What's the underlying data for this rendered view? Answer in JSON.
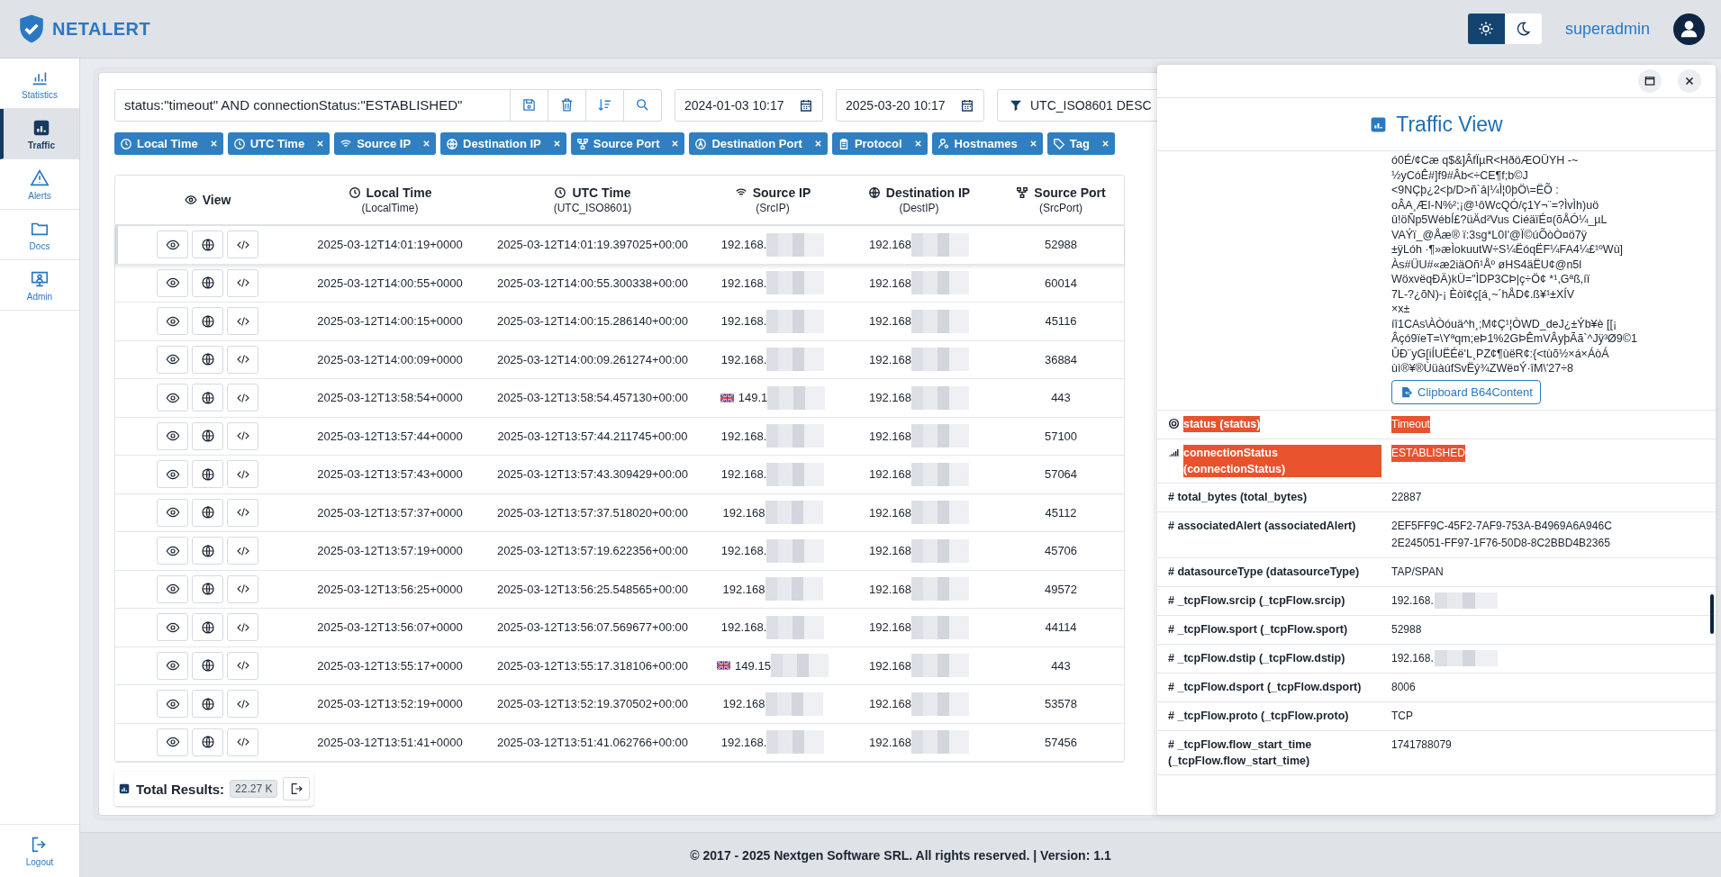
{
  "header": {
    "logo_text": "NETALERT",
    "theme_toggle": [
      {
        "kind": "light",
        "selected": true
      },
      {
        "kind": "dark",
        "selected": false
      }
    ],
    "user": "superadmin"
  },
  "sidebar": {
    "items": [
      {
        "label": "Statistics",
        "kind": "statistics",
        "selected": false
      },
      {
        "label": "Traffic",
        "kind": "traffic",
        "selected": true
      },
      {
        "label": "Alerts",
        "kind": "alerts",
        "selected": false
      },
      {
        "label": "Docs",
        "kind": "docs",
        "selected": false
      },
      {
        "label": "Admin",
        "kind": "admin",
        "selected": false
      }
    ],
    "logout": "Logout"
  },
  "toolbar": {
    "query": "status:\"timeout\" AND connectionStatus:\"ESTABLISHED\"",
    "date_from": "2024-01-03 10:17",
    "date_to": "2025-03-20 10:17",
    "sort": "UTC_ISO8601 DESC"
  },
  "column_chips": [
    {
      "label": "Local Time",
      "kind": "clock"
    },
    {
      "label": "UTC Time",
      "kind": "clock"
    },
    {
      "label": "Source IP",
      "kind": "wifi"
    },
    {
      "label": "Destination IP",
      "kind": "globe"
    },
    {
      "label": "Source Port",
      "kind": "network"
    },
    {
      "label": "Destination Port",
      "kind": "compass"
    },
    {
      "label": "Protocol",
      "kind": "clipboard"
    },
    {
      "label": "Hostnames",
      "kind": "user"
    },
    {
      "label": "Tag",
      "kind": "tag"
    }
  ],
  "table": {
    "columns": [
      {
        "title": "View",
        "kind": "eye"
      },
      {
        "title": "Local Time",
        "subtitle": "(LocalTime)",
        "kind": "clock"
      },
      {
        "title": "UTC Time",
        "subtitle": "(UTC_ISO8601)",
        "kind": "clock"
      },
      {
        "title": "Source IP",
        "subtitle": "(SrcIP)",
        "kind": "wifi"
      },
      {
        "title": "Destination IP",
        "subtitle": "(DestIP)",
        "kind": "globe"
      },
      {
        "title": "Source Port",
        "subtitle": "(SrcPort)",
        "kind": "network"
      }
    ],
    "rows": [
      {
        "local_time": "2025-03-12T14:01:19+0000",
        "utc_time": "2025-03-12T14:01:19.397025+00:00",
        "source_ip": "192.168.",
        "flag": false,
        "destination_ip": "192.168",
        "source_port": "52988",
        "selected": true
      },
      {
        "local_time": "2025-03-12T14:00:55+0000",
        "utc_time": "2025-03-12T14:00:55.300338+00:00",
        "source_ip": "192.168.",
        "flag": false,
        "destination_ip": "192.168",
        "source_port": "60014",
        "selected": false
      },
      {
        "local_time": "2025-03-12T14:00:15+0000",
        "utc_time": "2025-03-12T14:00:15.286140+00:00",
        "source_ip": "192.168.",
        "flag": false,
        "destination_ip": "192.168",
        "source_port": "45116",
        "selected": false
      },
      {
        "local_time": "2025-03-12T14:00:09+0000",
        "utc_time": "2025-03-12T14:00:09.261274+00:00",
        "source_ip": "192.168.",
        "flag": false,
        "destination_ip": "192.168",
        "source_port": "36884",
        "selected": false
      },
      {
        "local_time": "2025-03-12T13:58:54+0000",
        "utc_time": "2025-03-12T13:58:54.457130+00:00",
        "source_ip": "149.1",
        "flag": true,
        "destination_ip": "192.168",
        "source_port": "443",
        "selected": false
      },
      {
        "local_time": "2025-03-12T13:57:44+0000",
        "utc_time": "2025-03-12T13:57:44.211745+00:00",
        "source_ip": "192.168.",
        "flag": false,
        "destination_ip": "192.168",
        "source_port": "57100",
        "selected": false
      },
      {
        "local_time": "2025-03-12T13:57:43+0000",
        "utc_time": "2025-03-12T13:57:43.309429+00:00",
        "source_ip": "192.168.",
        "flag": false,
        "destination_ip": "192.168",
        "source_port": "57064",
        "selected": false
      },
      {
        "local_time": "2025-03-12T13:57:37+0000",
        "utc_time": "2025-03-12T13:57:37.518020+00:00",
        "source_ip": "192.168",
        "flag": false,
        "destination_ip": "192.168",
        "source_port": "45112",
        "selected": false
      },
      {
        "local_time": "2025-03-12T13:57:19+0000",
        "utc_time": "2025-03-12T13:57:19.622356+00:00",
        "source_ip": "192.168.",
        "flag": false,
        "destination_ip": "192.168",
        "source_port": "45706",
        "selected": false
      },
      {
        "local_time": "2025-03-12T13:56:25+0000",
        "utc_time": "2025-03-12T13:56:25.548565+00:00",
        "source_ip": "192.168",
        "flag": false,
        "destination_ip": "192.168",
        "source_port": "49572",
        "selected": false
      },
      {
        "local_time": "2025-03-12T13:56:07+0000",
        "utc_time": "2025-03-12T13:56:07.569677+00:00",
        "source_ip": "192.168.",
        "flag": false,
        "destination_ip": "192.168",
        "source_port": "44114",
        "selected": false
      },
      {
        "local_time": "2025-03-12T13:55:17+0000",
        "utc_time": "2025-03-12T13:55:17.318106+00:00",
        "source_ip": "149.15",
        "flag": true,
        "destination_ip": "192.168",
        "source_port": "443",
        "selected": false
      },
      {
        "local_time": "2025-03-12T13:52:19+0000",
        "utc_time": "2025-03-12T13:52:19.370502+00:00",
        "source_ip": "192.168",
        "flag": false,
        "destination_ip": "192.168",
        "source_port": "53578",
        "selected": false
      },
      {
        "local_time": "2025-03-12T13:51:41+0000",
        "utc_time": "2025-03-12T13:51:41.062766+00:00",
        "source_ip": "192.168.",
        "flag": false,
        "destination_ip": "192.168",
        "source_port": "57456",
        "selected": false
      }
    ]
  },
  "total": {
    "label": "Total Results:",
    "count": "22.27 K"
  },
  "drawer": {
    "title": "Traffic View",
    "content_lines": [
      "ó0É/¢Cæ q$&]ÂfÏµR<HðöÆOÜYH -~",
      "½yCóÊ#]f9#Âb<÷CE¶f;b©J",
      "<9NÇþ¿2<þ/D>ñ`â|¼Ì¦0þÖ\\=ËÕ :",
      "oÂA¸ÆI-N%²;¡@¹ôWcQÓ/ç1Y¬¨=?ÌvÌh)uö",
      "û!öÑp5WébÍ£?üÄd²Vus CiéäïÉ¤(õÅÓ¼_µL",
      "VAÝï_@Åæ® ï:3sg*L0I'@Ï©úÕòÒ¤ö7ÿ",
      "±ÿLóh ·¶»æÌokuutW÷S¼ËóqËF¼FA4¼£¹ºWù]",
      "Às#ÜU#«æ2iäOñ¹Åº øHS4äËU¢@n5l",
      "WöxvëqÐÄ)kÜ=\"ÌDP3CÞ|ç÷Ö¢ *¹,Gªß,íï",
      "7L-?¿õN)-¡ Èòî¢ç[á¸~´hÅD¢.ß¥¹±XÍV",
      "×x±",
      "íî1CAs\\ÀÒóuä^h¸;M¢Ç¹¦ÒWD_deJ¿±Ýb¥è [[¡",
      "Âçó9ïeT=\\Yªqm;eÞ1%2GÞÊmVÂyþÃã`^Jÿ³Ø9©1",
      "ÛÐ¨yG[iÍUËÉë'L¸PZ¢¶ùëR¢:{<tùõ½×á×ÁòÁ",
      "ùì®¥®ÙüàúfSvËý¾ZWë¤Ý·îM\\'27÷8"
    ],
    "clipboard_button": "Clipboard B64Content",
    "fields": [
      {
        "kind": "status",
        "label": "status (status)",
        "values": [
          "Timeout"
        ],
        "highlighted": true,
        "blurred": false
      },
      {
        "kind": "signal",
        "label": "connectionStatus (connectionStatus)",
        "values": [
          "ESTABLISHED"
        ],
        "highlighted": true,
        "blurred": false
      },
      {
        "kind": "hash",
        "label": "# total_bytes (total_bytes)",
        "values": [
          "22887"
        ],
        "highlighted": false,
        "blurred": false
      },
      {
        "kind": "hash",
        "label": "# associatedAlert (associatedAlert)",
        "values": [
          "2EF5FF9C-45F2-7AF9-753A-B4969A6A946C",
          "2E245051-FF97-1F76-50D8-8C2BBD4B2365"
        ],
        "highlighted": false,
        "blurred": false
      },
      {
        "kind": "hash",
        "label": "# datasourceType (datasourceType)",
        "values": [
          "TAP/SPAN"
        ],
        "highlighted": false,
        "blurred": false
      },
      {
        "kind": "hash",
        "label": "# _tcpFlow.srcip (_tcpFlow.srcip)",
        "values": [
          "192.168."
        ],
        "highlighted": false,
        "blurred": true
      },
      {
        "kind": "hash",
        "label": "# _tcpFlow.sport (_tcpFlow.sport)",
        "values": [
          "52988"
        ],
        "highlighted": false,
        "blurred": false
      },
      {
        "kind": "hash",
        "label": "# _tcpFlow.dstip (_tcpFlow.dstip)",
        "values": [
          "192.168."
        ],
        "highlighted": false,
        "blurred": true
      },
      {
        "kind": "hash",
        "label": "# _tcpFlow.dsport (_tcpFlow.dsport)",
        "values": [
          "8006"
        ],
        "highlighted": false,
        "blurred": false
      },
      {
        "kind": "hash",
        "label": "# _tcpFlow.proto (_tcpFlow.proto)",
        "values": [
          "TCP"
        ],
        "highlighted": false,
        "blurred": false
      },
      {
        "kind": "hash",
        "label": "# _tcpFlow.flow_start_time (_tcpFlow.flow_start_time)",
        "values": [
          "1741788079"
        ],
        "highlighted": false,
        "blurred": false
      }
    ]
  },
  "footer": "© 2017 - 2025 Nextgen Software SRL. All rights reserved. | Version: 1.1"
}
